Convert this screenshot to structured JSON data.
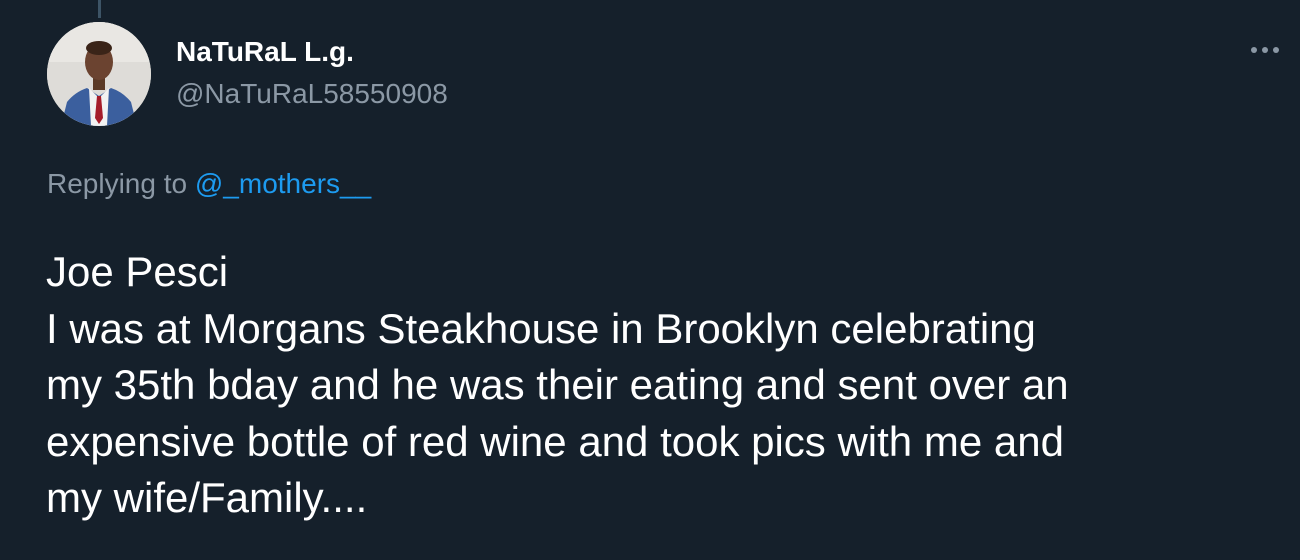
{
  "tweet": {
    "display_name": "NaTuRaL L.g.",
    "handle": "@NaTuRaL58550908",
    "replying_prefix": "Replying to ",
    "replying_mention": "@_mothers__",
    "text_lines": [
      "Joe Pesci",
      "I was at Morgans Steakhouse in Brooklyn celebrating",
      "my 35th bday and he was their eating and sent over an",
      "expensive bottle of red wine and took pics with me and",
      "my wife/Family...."
    ],
    "avatar_icon": "profile-photo-icon",
    "more_icon": "more-options-icon"
  },
  "colors": {
    "background": "#15202b",
    "primary_text": "#ffffff",
    "secondary_text": "#8b98a5",
    "link": "#1d9bf0"
  }
}
